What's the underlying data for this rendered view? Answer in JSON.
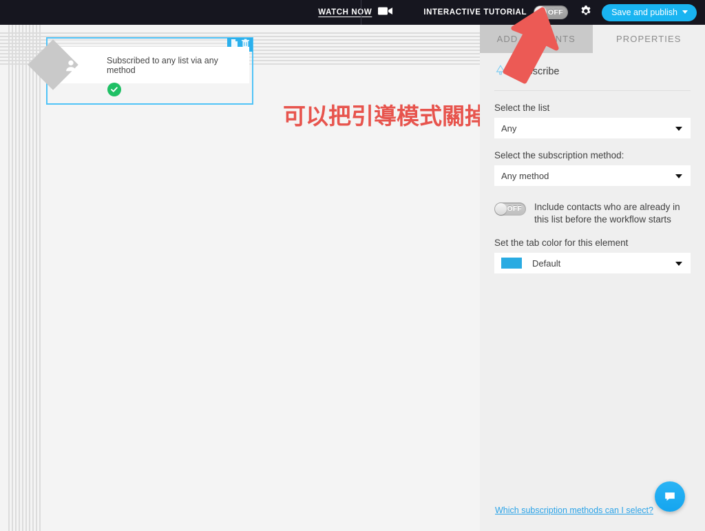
{
  "topbar": {
    "watch_now_label": "WATCH NOW",
    "camera_icon": "video-camera-icon",
    "tutorial_label": "INTERACTIVE TUTORIAL",
    "tutorial_toggle_state": "OFF",
    "gear_icon": "gear-icon",
    "save_button_label": "Save and publish",
    "accent_color": "#19b4f1",
    "background_color": "#16161f"
  },
  "canvas": {
    "node": {
      "label": "Subscribed to any list via any method",
      "person_icon": "person-icon",
      "duplicate_icon": "duplicate-icon",
      "delete_icon": "trash-icon",
      "status_icon": "check-circle-icon",
      "selection_color": "#4fc3f7",
      "status_color": "#1fc065"
    },
    "annotation": {
      "text": "可以把引導模式關掉",
      "color": "#e7544d"
    }
  },
  "panel": {
    "tabs": [
      {
        "label": "ADD ELEMENTS",
        "active": false
      },
      {
        "label": "PROPERTIES",
        "active": true
      }
    ],
    "element": {
      "title": "Subscribe",
      "icon": "subscribe-icon"
    },
    "fields": [
      {
        "label": "Select the list",
        "value": "Any"
      },
      {
        "label": "Select the subscription method:",
        "value": "Any method"
      }
    ],
    "include_contacts": {
      "toggle_state": "OFF",
      "text": "Include contacts who are already in this list before the workflow starts"
    },
    "tab_color": {
      "label": "Set the tab color for this element",
      "value": "Default",
      "swatch_color": "#29abe2"
    },
    "help_link": "Which subscription methods can I select?",
    "chat_icon": "chat-bubble-icon"
  }
}
